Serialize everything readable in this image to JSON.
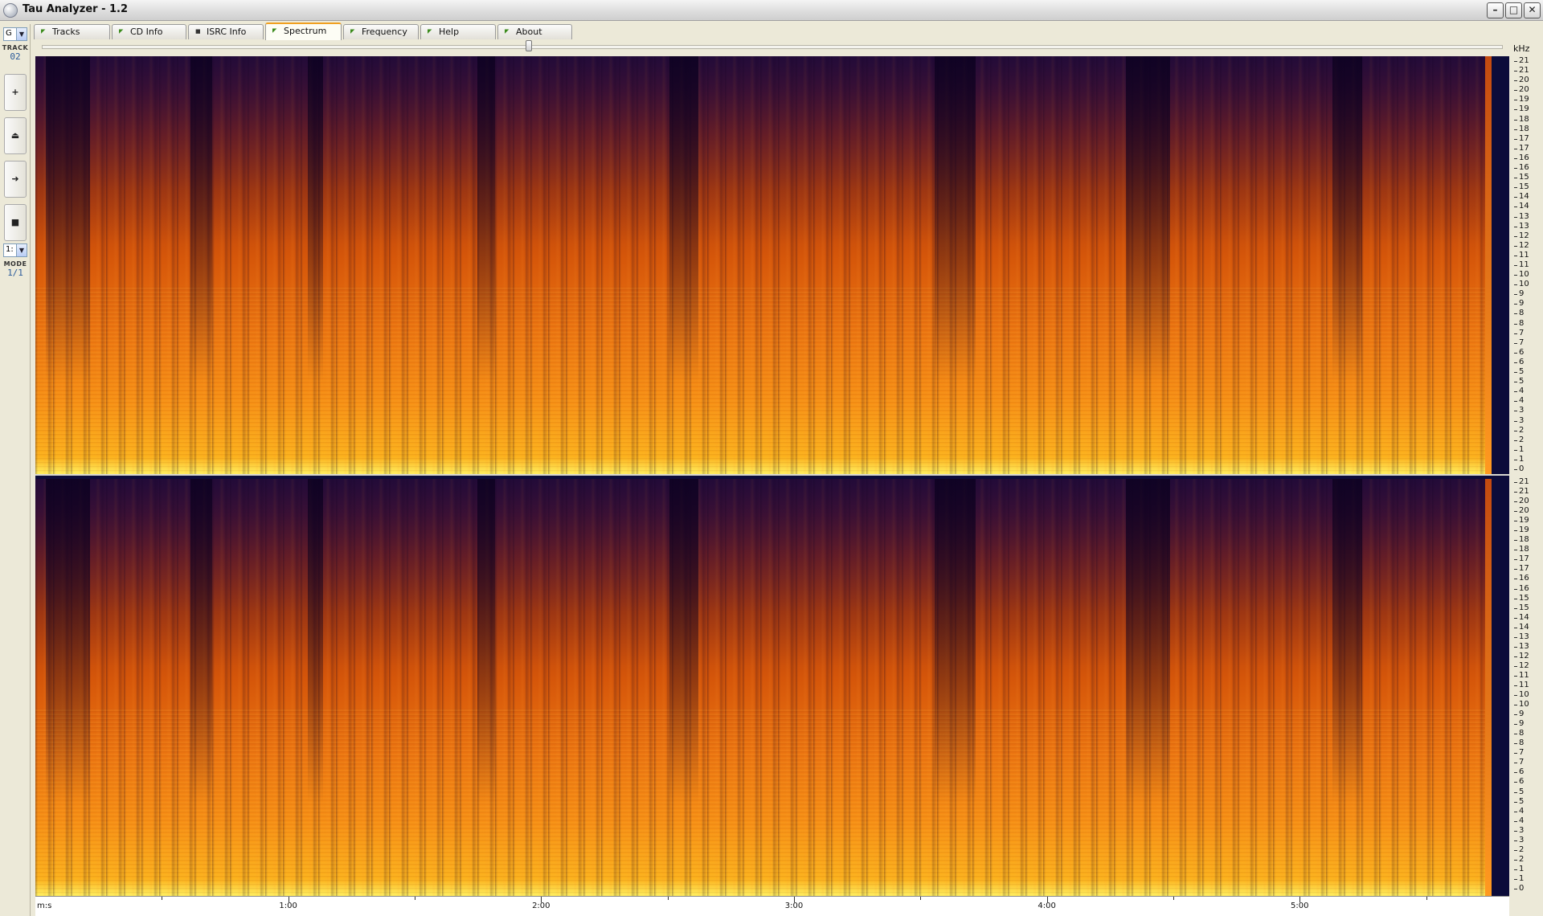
{
  "window": {
    "title": "Tau Analyzer - 1.2",
    "controls": {
      "minimize": "–",
      "maximize": "□",
      "close": "✕"
    }
  },
  "sidebar": {
    "combo_top": "G",
    "track_label": "TRACK",
    "track_value": "02",
    "buttons": [
      {
        "name": "add-button",
        "glyph": "+"
      },
      {
        "name": "eject-button",
        "glyph": "⏏"
      },
      {
        "name": "forward-button",
        "glyph": "➜"
      },
      {
        "name": "stop-button",
        "glyph": "■"
      }
    ],
    "combo_bottom": "1:",
    "mode_label": "MODE",
    "mode_value": "1/1"
  },
  "tabs": [
    {
      "label": "Tracks",
      "active": false
    },
    {
      "label": "CD Info",
      "active": false
    },
    {
      "label": "ISRC Info",
      "active": false
    },
    {
      "label": "Spectrum",
      "active": true
    },
    {
      "label": "Frequency",
      "active": false
    },
    {
      "label": "Help",
      "active": false
    },
    {
      "label": "About",
      "active": false
    }
  ],
  "spectrum": {
    "unit_label": "kHz",
    "freq_ticks": [
      "21",
      "21",
      "20",
      "20",
      "19",
      "19",
      "18",
      "18",
      "17",
      "17",
      "16",
      "16",
      "15",
      "15",
      "14",
      "14",
      "13",
      "13",
      "12",
      "12",
      "11",
      "11",
      "10",
      "10",
      "9",
      "9",
      "8",
      "8",
      "7",
      "7",
      "6",
      "6",
      "5",
      "5",
      "4",
      "4",
      "3",
      "3",
      "2",
      "2",
      "1",
      "1",
      "0"
    ],
    "time_unit": "m:s",
    "time_labels": [
      "1:00",
      "2:00",
      "3:00",
      "4:00",
      "5:00"
    ],
    "duration_seconds": 344,
    "colors": {
      "background": "#0c0c3a",
      "low": "#2a0d3e",
      "mid": "#d5560a",
      "high": "#fff060"
    }
  }
}
